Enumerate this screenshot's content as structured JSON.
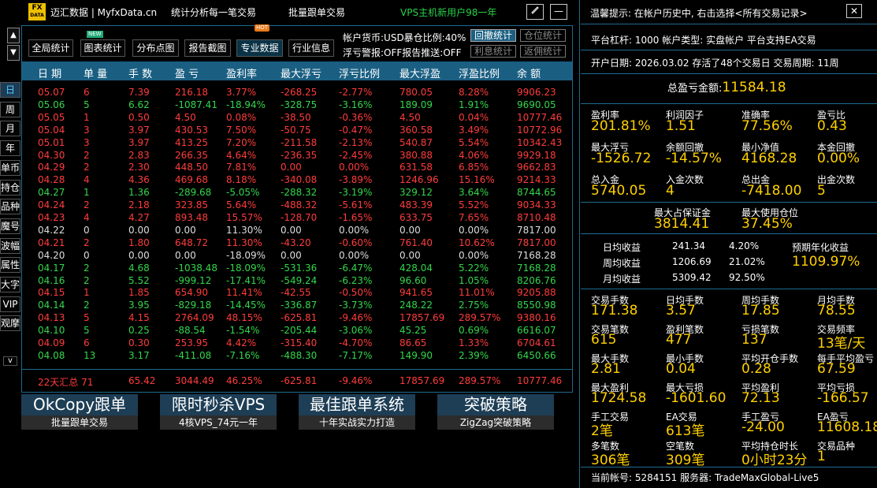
{
  "topbar": {
    "logo_top": "FX",
    "logo_bottom": "DATA",
    "title": "迈汇数据 | MyfxData.cn",
    "slogan": "统计分析每一笔交易",
    "copy_trade": "批量跟单交易",
    "promo": "VPS主机新用户98一年",
    "edit_icon": "edit-icon",
    "minimize_label": "—"
  },
  "nav": {
    "up": "▲",
    "down": "▼",
    "items": [
      "日",
      "周",
      "月",
      "年",
      "单币",
      "持仓",
      "品种",
      "魔号",
      "波幅",
      "属性",
      "大字",
      "VIP",
      "观摩"
    ],
    "more": "v"
  },
  "toolbar": {
    "buttons": [
      "全局统计",
      "图表统计",
      "分布点图",
      "报告截图",
      "专业数据",
      "行业信息"
    ],
    "badge_new": "NEW",
    "badge_hot": "HOT",
    "account_info": "帐户货币:USD暴仓比例:40%",
    "float_alert": "浮亏警报:OFF报告推送:OFF",
    "btn_dd": "回撤统计",
    "btn_pos": "仓位统计",
    "btn_interest": "利息统计",
    "btn_rebate": "返佣统计"
  },
  "table": {
    "headers": [
      "日 期",
      "单 量",
      "手 数",
      "盈 亏",
      "盈利率",
      "最大浮亏",
      "浮亏比例",
      "最大浮盈",
      "浮盈比例",
      "余 额"
    ],
    "rows": [
      {
        "c": "red",
        "v": [
          "05.07",
          "6",
          "7.39",
          "216.18",
          "3.77%",
          "-268.25",
          "-2.77%",
          "780.05",
          "8.28%",
          "9906.23"
        ]
      },
      {
        "c": "green",
        "v": [
          "05.06",
          "5",
          "6.62",
          "-1087.41",
          "-18.94%",
          "-328.75",
          "-3.16%",
          "189.09",
          "1.91%",
          "9690.05"
        ]
      },
      {
        "c": "red",
        "v": [
          "05.05",
          "1",
          "0.50",
          "4.50",
          "0.08%",
          "-38.50",
          "-0.36%",
          "4.50",
          "0.04%",
          "10777.46"
        ]
      },
      {
        "c": "red",
        "v": [
          "05.04",
          "3",
          "3.97",
          "430.53",
          "7.50%",
          "-50.75",
          "-0.47%",
          "360.58",
          "3.49%",
          "10772.96"
        ]
      },
      {
        "c": "red",
        "v": [
          "05.01",
          "3",
          "3.97",
          "413.25",
          "7.20%",
          "-211.58",
          "-2.13%",
          "540.87",
          "5.54%",
          "10342.43"
        ]
      },
      {
        "c": "red",
        "v": [
          "04.30",
          "2",
          "2.83",
          "266.35",
          "4.64%",
          "-236.35",
          "-2.45%",
          "380.88",
          "4.06%",
          "9929.18"
        ]
      },
      {
        "c": "red",
        "v": [
          "04.29",
          "2",
          "2.30",
          "448.50",
          "7.81%",
          "0.00",
          "0.00%",
          "631.58",
          "6.85%",
          "9662.83"
        ]
      },
      {
        "c": "red",
        "v": [
          "04.28",
          "4",
          "4.36",
          "469.68",
          "8.18%",
          "-340.08",
          "-3.89%",
          "1246.96",
          "15.16%",
          "9214.33"
        ]
      },
      {
        "c": "green",
        "v": [
          "04.27",
          "1",
          "1.36",
          "-289.68",
          "-5.05%",
          "-288.32",
          "-3.19%",
          "329.12",
          "3.64%",
          "8744.65"
        ]
      },
      {
        "c": "red",
        "v": [
          "04.24",
          "2",
          "2.18",
          "323.85",
          "5.64%",
          "-488.32",
          "-5.61%",
          "483.39",
          "5.52%",
          "9034.33"
        ]
      },
      {
        "c": "red",
        "v": [
          "04.23",
          "4",
          "4.27",
          "893.48",
          "15.57%",
          "-128.70",
          "-1.65%",
          "633.75",
          "7.65%",
          "8710.48"
        ]
      },
      {
        "c": "gray",
        "v": [
          "04.22",
          "0",
          "0.00",
          "0.00",
          "11.30%",
          "0.00",
          "0.00%",
          "0.00",
          "0.00%",
          "7817.00"
        ]
      },
      {
        "c": "red",
        "v": [
          "04.21",
          "2",
          "1.80",
          "648.72",
          "11.30%",
          "-43.20",
          "-0.60%",
          "761.40",
          "10.62%",
          "7817.00"
        ]
      },
      {
        "c": "gray",
        "v": [
          "04.20",
          "0",
          "0.00",
          "0.00",
          "-18.09%",
          "0.00",
          "0.00%",
          "0.00",
          "0.00%",
          "7168.28"
        ]
      },
      {
        "c": "green",
        "v": [
          "04.17",
          "2",
          "4.68",
          "-1038.48",
          "-18.09%",
          "-531.36",
          "-6.47%",
          "428.04",
          "5.22%",
          "7168.28"
        ]
      },
      {
        "c": "green",
        "v": [
          "04.16",
          "2",
          "5.52",
          "-999.12",
          "-17.41%",
          "-549.24",
          "-6.23%",
          "96.60",
          "1.05%",
          "8206.76"
        ]
      },
      {
        "c": "red",
        "v": [
          "04.15",
          "1",
          "1.85",
          "654.90",
          "11.41%",
          "-42.55",
          "-0.50%",
          "941.65",
          "11.01%",
          "9205.88"
        ]
      },
      {
        "c": "green",
        "v": [
          "04.14",
          "2",
          "3.95",
          "-829.18",
          "-14.45%",
          "-336.87",
          "-3.73%",
          "248.22",
          "2.75%",
          "8550.98"
        ]
      },
      {
        "c": "red",
        "v": [
          "04.13",
          "5",
          "4.15",
          "2764.09",
          "48.15%",
          "-625.81",
          "-9.46%",
          "17857.69",
          "289.57%",
          "9380.16"
        ]
      },
      {
        "c": "green",
        "v": [
          "04.10",
          "5",
          "0.25",
          "-88.54",
          "-1.54%",
          "-205.44",
          "-3.06%",
          "45.25",
          "0.69%",
          "6616.07"
        ]
      },
      {
        "c": "red",
        "v": [
          "04.09",
          "6",
          "0.30",
          "253.95",
          "4.42%",
          "-315.40",
          "-4.70%",
          "86.65",
          "1.33%",
          "6704.61"
        ]
      },
      {
        "c": "green",
        "v": [
          "04.08",
          "13",
          "3.17",
          "-411.08",
          "-7.16%",
          "-488.30",
          "-7.17%",
          "149.90",
          "2.39%",
          "6450.66"
        ]
      }
    ],
    "summary": [
      "22天汇总 71",
      "",
      "65.42",
      "3044.49",
      "46.25%",
      "-625.81",
      "-9.46%",
      "17857.69",
      "289.57%",
      "10777.46"
    ]
  },
  "promos": [
    {
      "title": "OkCopy跟单",
      "sub": "批量跟单交易"
    },
    {
      "title": "限时秒杀VPS",
      "sub": "4核VPS_74元一年"
    },
    {
      "title": "最佳跟单系统",
      "sub": "十年实战实力打造"
    },
    {
      "title": "突破策略",
      "sub": "ZigZag突破策略"
    }
  ],
  "right": {
    "tip": "温馨提示: 在帐户历史中, 右击选择<所有交易记录>",
    "close": "✕",
    "line1": "平台杠杆: 1000   帐户类型: 实盘帐户   平台支持EA交易",
    "line2": "开户日期: 2026.03.02 存活了48个交易日  交易周期: 11周",
    "total_label": "总盈亏金额:",
    "total_value": "11584.18",
    "grid1": [
      [
        {
          "l": "盈利率",
          "v": "201.81%"
        },
        {
          "l": "利润因子",
          "v": "1.51"
        },
        {
          "l": "准确率",
          "v": "77.56%"
        },
        {
          "l": "盈亏比",
          "v": "0.43"
        }
      ],
      [
        {
          "l": "最大浮亏",
          "v": "-1526.72"
        },
        {
          "l": "余额回撤",
          "v": "-14.57%"
        },
        {
          "l": "最小净值",
          "v": "4168.28"
        },
        {
          "l": "本金回撤",
          "v": "0.00%"
        }
      ],
      [
        {
          "l": "总入金",
          "v": "5740.05"
        },
        {
          "l": "入金次数",
          "v": "4"
        },
        {
          "l": "总出金",
          "v": "-7418.00"
        },
        {
          "l": "出金次数",
          "v": "5"
        }
      ]
    ],
    "margin": [
      {
        "l": "最大占保证金",
        "v": "3814.41"
      },
      {
        "l": "最大使用仓位",
        "v": "37.45%"
      }
    ],
    "period": [
      {
        "l": "日均收益",
        "a": "241.34",
        "p": "4.20%"
      },
      {
        "l": "周均收益",
        "a": "1206.69",
        "p": "21.02%"
      },
      {
        "l": "月均收益",
        "a": "5309.42",
        "p": "92.50%"
      }
    ],
    "annual_label": "预期年化收益",
    "annual_value": "1109.97%",
    "grid2": [
      [
        {
          "l": "交易手数",
          "v": "171.38"
        },
        {
          "l": "日均手数",
          "v": "3.57"
        },
        {
          "l": "周均手数",
          "v": "17.85"
        },
        {
          "l": "月均手数",
          "v": "78.55"
        }
      ],
      [
        {
          "l": "交易笔数",
          "v": "615"
        },
        {
          "l": "盈利笔数",
          "v": "477"
        },
        {
          "l": "亏损笔数",
          "v": "137"
        },
        {
          "l": "交易频率",
          "v": "13笔/天"
        }
      ],
      [
        {
          "l": "最大手数",
          "v": "2.81"
        },
        {
          "l": "最小手数",
          "v": "0.04"
        },
        {
          "l": "平均开仓手数",
          "v": "0.28"
        },
        {
          "l": "每手平均盈亏",
          "v": "67.59"
        }
      ],
      [
        {
          "l": "最大盈利",
          "v": "1724.58"
        },
        {
          "l": "最大亏损",
          "v": "-1601.60"
        },
        {
          "l": "平均盈利",
          "v": "72.13"
        },
        {
          "l": "平均亏损",
          "v": "-166.57"
        }
      ],
      [
        {
          "l": "手工交易",
          "v": "2笔"
        },
        {
          "l": "EA交易",
          "v": "613笔"
        },
        {
          "l": "手工盈亏",
          "v": "-24.00"
        },
        {
          "l": "EA盈亏",
          "v": "11608.18"
        }
      ],
      [
        {
          "l": "多笔数",
          "v": "306笔"
        },
        {
          "l": "空笔数",
          "v": "309笔"
        },
        {
          "l": "平均持仓时长",
          "v": "0小时23分"
        },
        {
          "l": "交易品种",
          "v": "1"
        }
      ]
    ],
    "footer": "当前帐号:  5284151 服务器:  TradeMaxGlobal-Live5"
  }
}
